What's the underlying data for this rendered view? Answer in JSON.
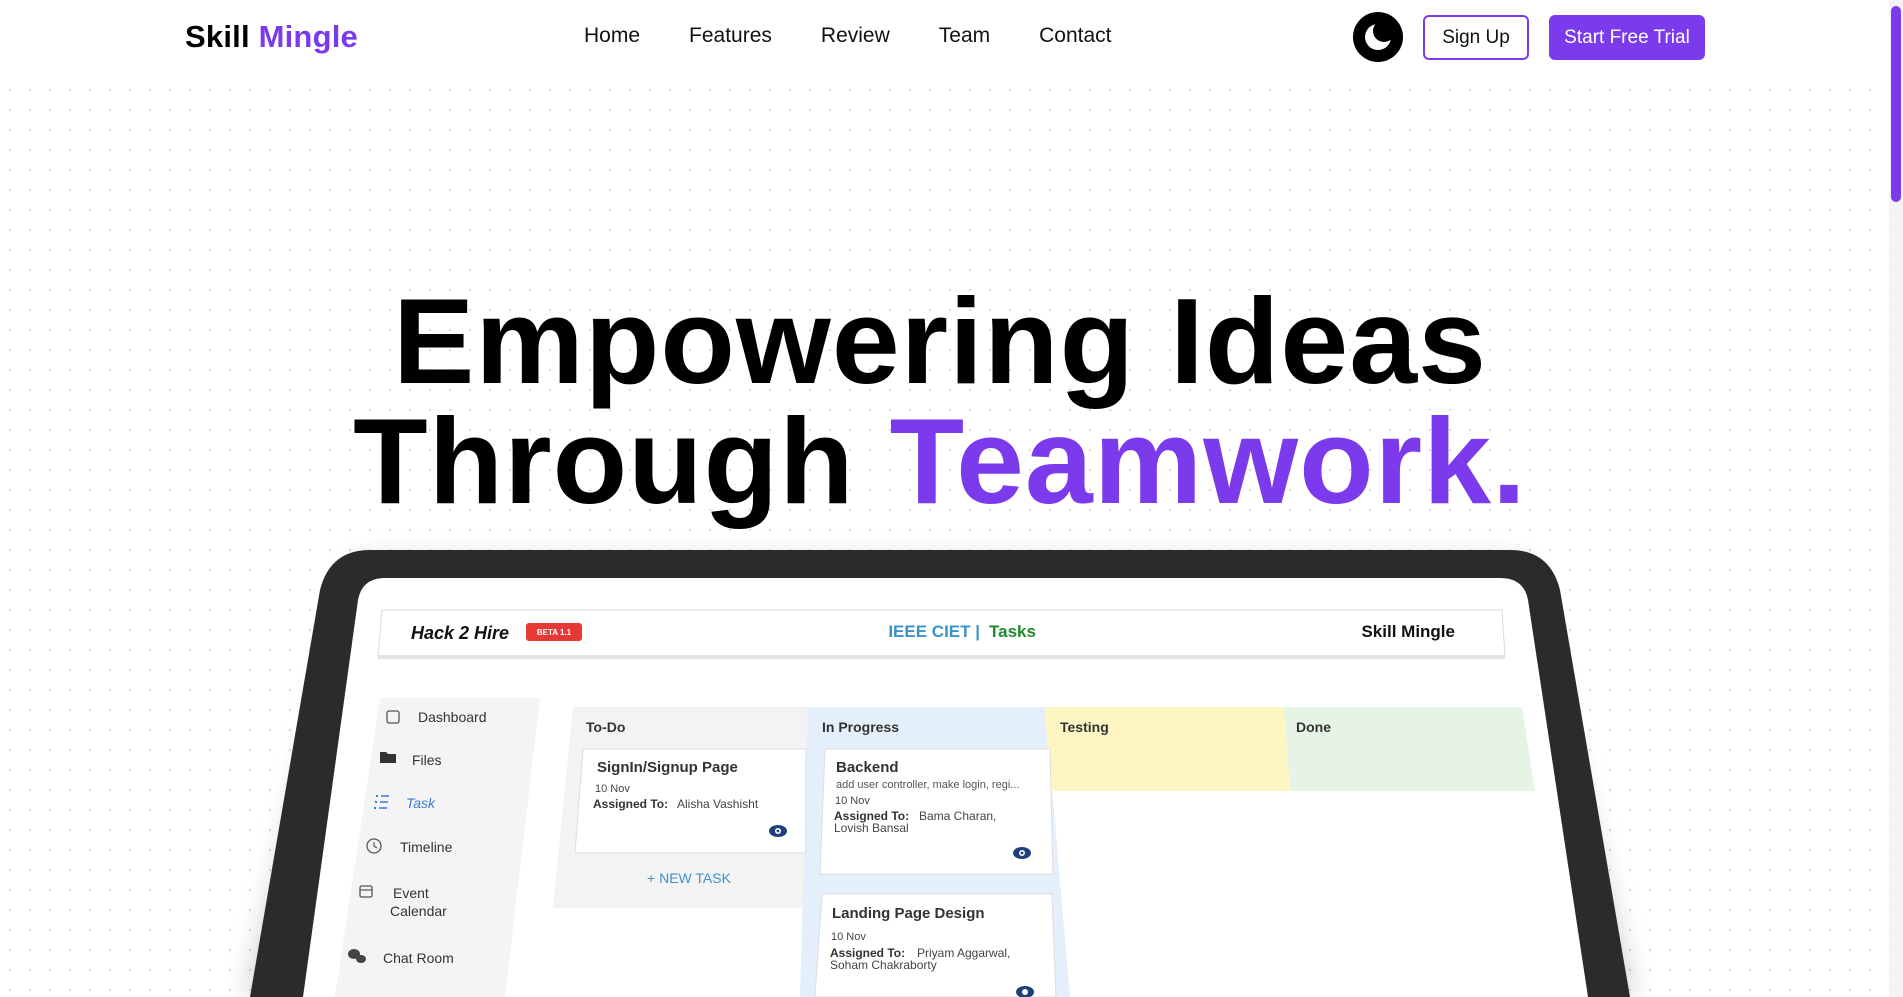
{
  "nav": {
    "logo_primary": "Skill",
    "logo_accent": "Mingle",
    "links": [
      "Home",
      "Features",
      "Review",
      "Team",
      "Contact"
    ],
    "theme_icon": "moon-icon",
    "signup_label": "Sign Up",
    "trial_label": "Start Free Trial",
    "accent_color": "#7c3aed"
  },
  "hero": {
    "line1": "Empowering Ideas",
    "line2_prefix": "Through",
    "line2_accent": "Teamwork."
  },
  "app": {
    "brand": "Hack 2 Hire",
    "badge": "BETA 1.1",
    "org": "IEEE CIET |",
    "section": "Tasks",
    "right_brand": "Skill Mingle",
    "sidebar": [
      {
        "label": "Dashboard",
        "icon": "dashboard-icon"
      },
      {
        "label": "Files",
        "icon": "folder-icon"
      },
      {
        "label": "Task",
        "icon": "task-list-icon"
      },
      {
        "label": "Timeline",
        "icon": "clock-icon"
      },
      {
        "label": "Event",
        "icon": "calendar-icon"
      },
      {
        "label": "Calendar",
        "icon": "calendar-icon"
      },
      {
        "label": "Chat Room",
        "icon": "chat-icon"
      }
    ],
    "columns": [
      "To-Do",
      "In Progress",
      "Testing",
      "Done"
    ],
    "column_colors": [
      "#f3f3f3",
      "#e3f0fb",
      "#fdf6c3",
      "#e6f4e6"
    ],
    "cards": {
      "todo1": {
        "title": "SignIn/Signup Page",
        "date": "10 Nov",
        "assigned_label": "Assigned To:",
        "assigned": "Alisha Vashisht"
      },
      "prog1": {
        "title": "Backend",
        "desc": "add user controller, make login, regi...",
        "date": "10 Nov",
        "assigned_label": "Assigned To:",
        "assigned_line1": "Bama Charan,",
        "assigned_line2": "Lovish Bansal"
      },
      "prog2": {
        "title": "Landing Page Design",
        "date": "10 Nov",
        "assigned_label": "Assigned To:",
        "assigned_line1": "Priyam Aggarwal,",
        "assigned_line2": "Soham Chakraborty"
      }
    },
    "new_task": "+ NEW TASK"
  }
}
